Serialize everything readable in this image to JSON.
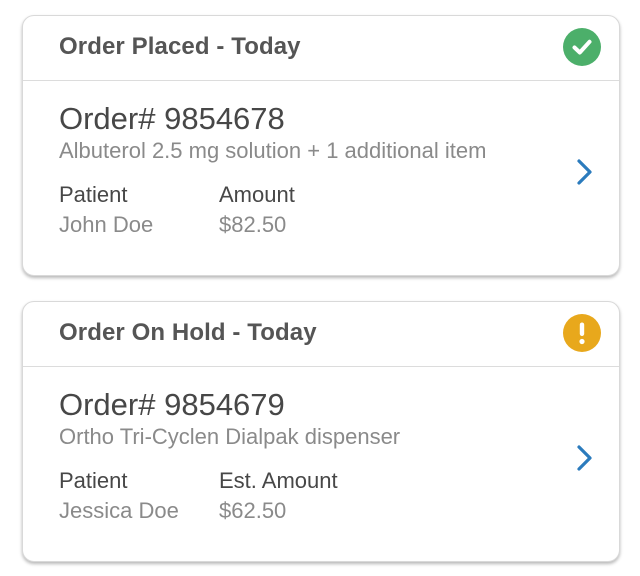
{
  "orders": [
    {
      "header": "Order Placed - Today",
      "status_icon": "check-icon",
      "status_color": "#4caf6a",
      "order_number": "Order# 9854678",
      "items": "Albuterol 2.5 mg solution + 1 additional item",
      "patient_label": "Patient",
      "patient_name": "John Doe",
      "amount_label": "Amount",
      "amount": "$82.50"
    },
    {
      "header": "Order On Hold - Today",
      "status_icon": "exclamation-icon",
      "status_color": "#e8a81c",
      "order_number": "Order# 9854679",
      "items": "Ortho Tri-Cyclen Dialpak dispenser",
      "patient_label": "Patient",
      "patient_name": "Jessica Doe",
      "amount_label": "Est. Amount",
      "amount": "$62.50"
    }
  ],
  "colors": {
    "chevron": "#2b7bbd",
    "title_text": "#555555",
    "secondary_text": "#8a8a8a"
  }
}
